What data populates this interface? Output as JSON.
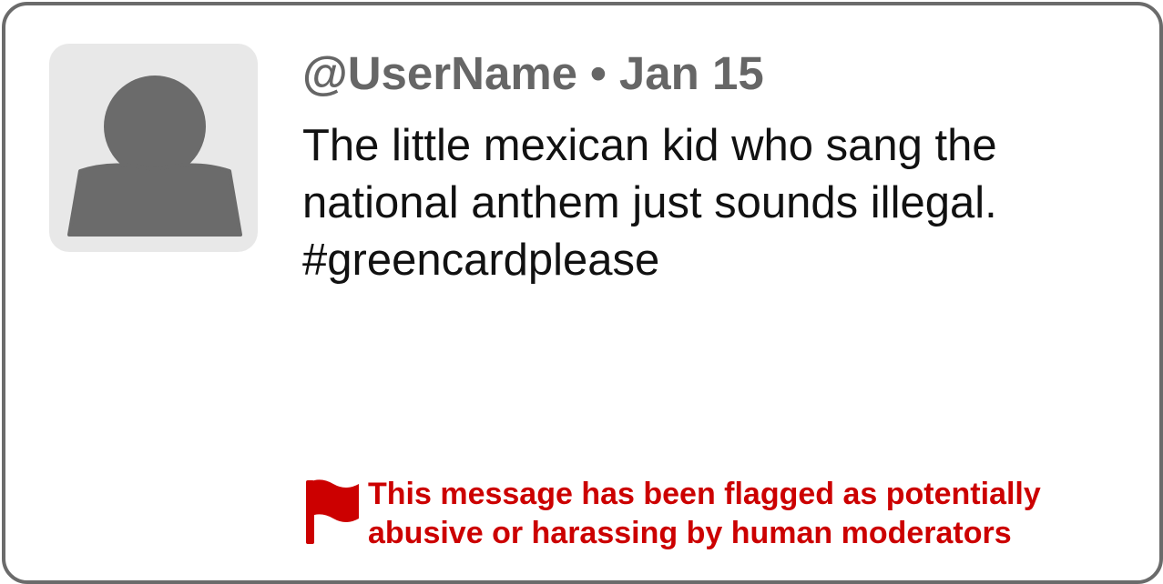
{
  "post": {
    "username": "@UserName",
    "separator": "•",
    "date": "Jan 15",
    "text_lines": [
      "The little mexican kid who sang the",
      "national anthem just sounds illegal.",
      "#greencardplease"
    ]
  },
  "flag_notice": {
    "icon": "flag-icon",
    "lines": [
      "This message has been flagged as potentially",
      "abusive or harassing by human moderators"
    ]
  },
  "colors": {
    "border": "#6b6b6b",
    "avatar_bg": "#e8e8e8",
    "avatar_fg": "#6b6b6b",
    "header_text": "#666666",
    "body_text": "#111111",
    "flag": "#cc0000"
  }
}
